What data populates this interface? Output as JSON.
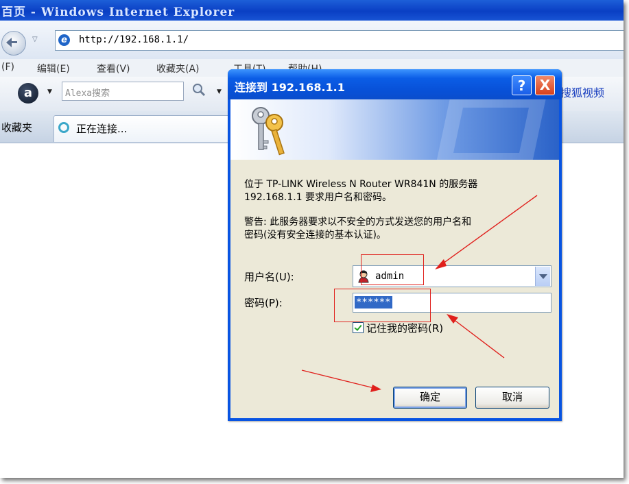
{
  "browser": {
    "window_title": "百页 - Windows Internet Explorer",
    "address": "http://192.168.1.1/",
    "menu": [
      "(F)",
      "编辑(E)",
      "查看(V)",
      "收藏夹(A)",
      "工具(T)",
      "帮助(H)"
    ],
    "search_placeholder": "Alexa搜索",
    "sohu_link": "搜狐视频",
    "favorites_label": "收藏夹",
    "tab_label": "正在连接..."
  },
  "dialog": {
    "title": "连接到 192.168.1.1",
    "help_glyph": "?",
    "close_glyph": "X",
    "message_line1": "位于 TP-LINK Wireless N Router WR841N 的服务器",
    "message_line2": "192.168.1.1 要求用户名和密码。",
    "warning_line1": "警告: 此服务器要求以不安全的方式发送您的用户名和",
    "warning_line2": "密码(没有安全连接的基本认证)。",
    "username_label": "用户名(U):",
    "username_value": "admin",
    "password_label": "密码(P):",
    "password_value": "******",
    "remember_label": "记住我的密码(R)",
    "remember_checked": true,
    "ok_label": "确定",
    "cancel_label": "取消"
  },
  "colors": {
    "xp_title_blue": "#0854e2",
    "dialog_face": "#ece9d8",
    "annotation_red": "#e0201c"
  }
}
